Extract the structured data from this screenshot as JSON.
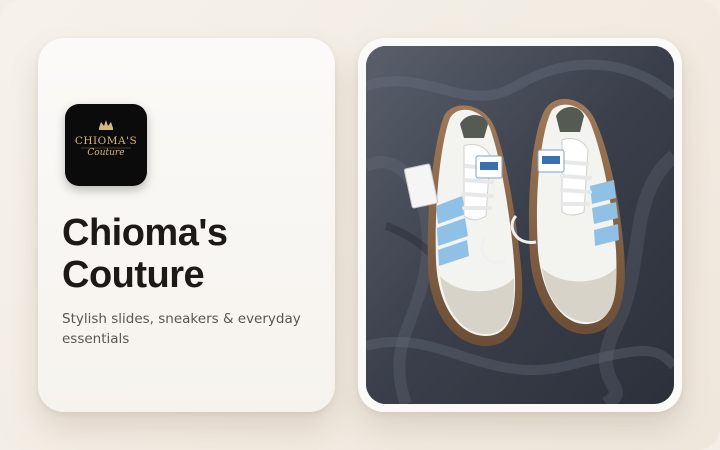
{
  "brand": {
    "logo_line1": "CHIOMA'S",
    "logo_line2": "Couture",
    "name": "Chioma's Couture",
    "tagline": "Stylish slides, sneakers & everyday essentials"
  },
  "photo": {
    "subject": "white sneakers with light blue stripes on dark satin fabric"
  },
  "colors": {
    "background": "#f4efe6",
    "card": "#fbfaf8",
    "title": "#1d1915",
    "subtitle": "#5b5550",
    "logo_bg": "#0b0b0b",
    "logo_gold": "#d8b87a",
    "stripe_blue": "#8fc0e6",
    "fabric": "#3d4250"
  }
}
